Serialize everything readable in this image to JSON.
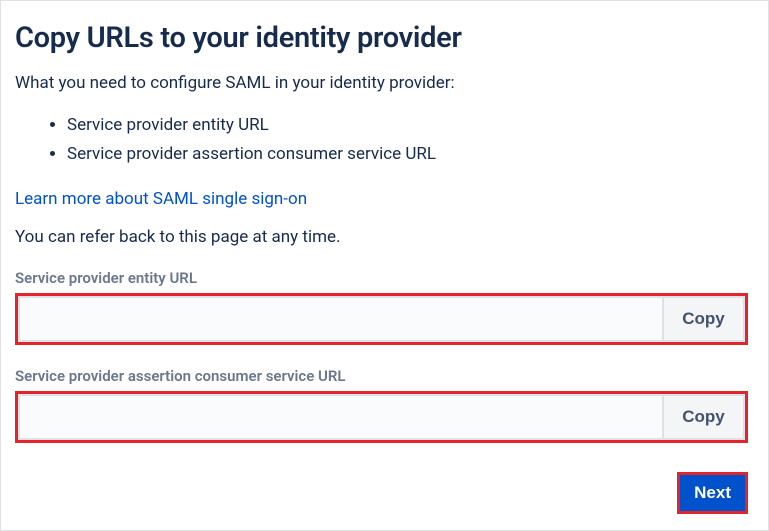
{
  "heading": "Copy URLs to your identity provider",
  "intro": "What you need to configure SAML in your identity provider:",
  "bullets": [
    "Service provider entity URL",
    "Service provider assertion consumer service URL"
  ],
  "learn_more": "Learn more about SAML single sign-on",
  "refer_text": "You can refer back to this page at any time.",
  "fields": {
    "entity": {
      "label": "Service provider entity URL",
      "value": "",
      "copy_label": "Copy"
    },
    "acs": {
      "label": "Service provider assertion consumer service URL",
      "value": "",
      "copy_label": "Copy"
    }
  },
  "next_label": "Next"
}
